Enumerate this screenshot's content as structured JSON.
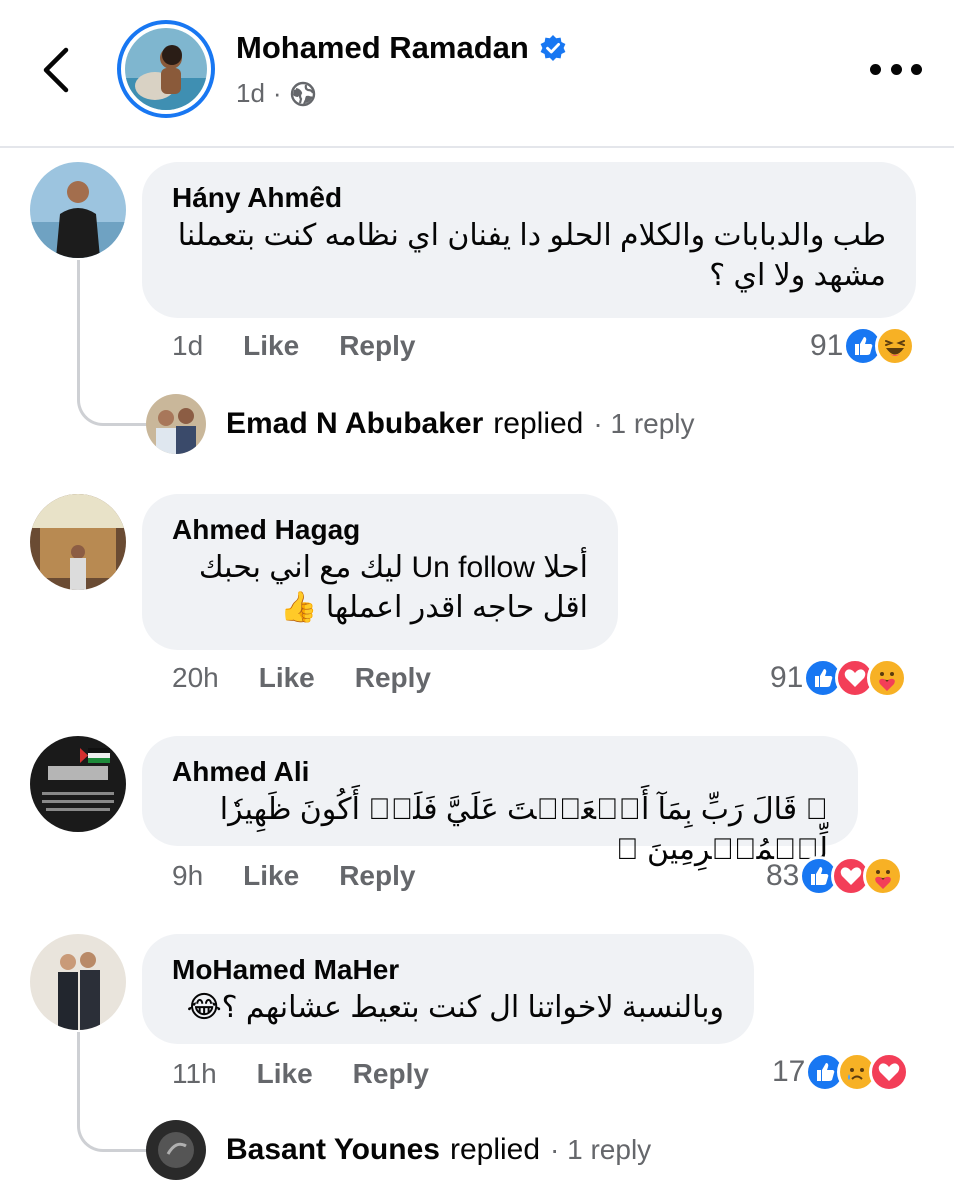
{
  "header": {
    "page_name": "Mohamed Ramadan",
    "time": "1d",
    "separator": "·",
    "icons": {
      "back": "chevron-left-icon",
      "verified": "verified-badge-icon",
      "audience": "globe-icon",
      "more": "more-horizontal-icon"
    }
  },
  "colors": {
    "accent": "#1877f2",
    "love": "#f33e58",
    "emoji_yellow": "#f7b125",
    "secondary_text": "#65676b",
    "bubble": "#f0f2f5"
  },
  "comments": [
    {
      "author": "Hány Ahmêd",
      "lines": [
        "طب والدبابات والكلام الحلو دا يفنان اي نظامه كنت بتعملنا",
        "مشهد ولا اي ؟"
      ],
      "time": "1d",
      "like_label": "Like",
      "reply_label": "Reply",
      "reaction_count": "91",
      "reactions": [
        "like",
        "haha"
      ],
      "reply_summary": {
        "name": "Emad N Abubaker",
        "verb": "replied",
        "count": "· 1 reply"
      }
    },
    {
      "author": "Ahmed Hagag",
      "lines": [
        "أحلا Un follow ليك مع اني بحبك",
        "اقل حاجه اقدر اعملها 👍"
      ],
      "time": "20h",
      "like_label": "Like",
      "reply_label": "Reply",
      "reaction_count": "91",
      "reactions": [
        "like",
        "love",
        "care"
      ]
    },
    {
      "author": "Ahmed Ali",
      "lines": [
        "﴿ قَالَ رَبِّ بِمَآ أَنۡعَمۡتَ عَلَيَّ فَلَنۡ أَكُونَ ظَهِيرٗا لِّلۡمُجۡرِمِينَ ﴾"
      ],
      "time": "9h",
      "like_label": "Like",
      "reply_label": "Reply",
      "reaction_count": "83",
      "reactions": [
        "like",
        "love",
        "care"
      ]
    },
    {
      "author": "MoHamed MaHer",
      "lines": [
        "وبالنسبة لاخواتنا ال كنت بتعيط عشانهم ؟😂"
      ],
      "time": "11h",
      "like_label": "Like",
      "reply_label": "Reply",
      "reaction_count": "17",
      "reactions": [
        "like",
        "sad",
        "love"
      ],
      "reply_summary": {
        "name": "Basant Younes",
        "verb": "replied",
        "count": "· 1 reply"
      }
    }
  ]
}
